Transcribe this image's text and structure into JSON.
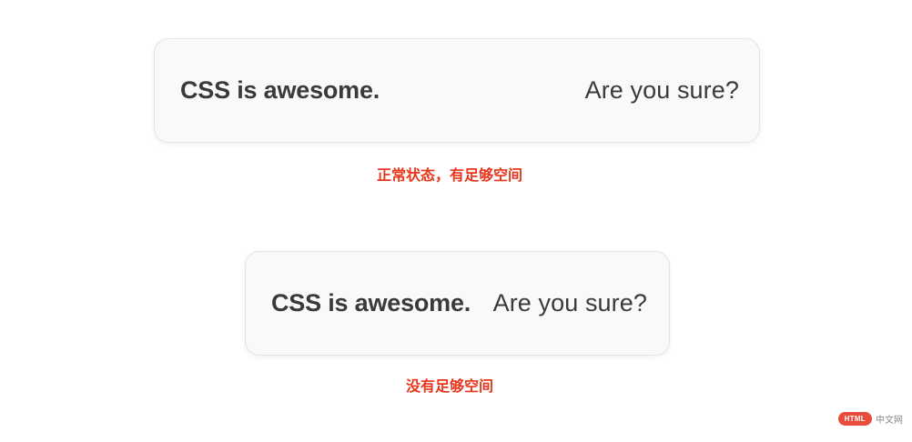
{
  "demo_normal": {
    "bold_text": "CSS is awesome.",
    "plain_text": "Are you sure?",
    "caption": "正常状态，有足够空间"
  },
  "demo_tight": {
    "bold_text": "CSS is awesome.",
    "plain_text": "Are you sure?",
    "caption": "没有足够空间"
  },
  "watermark": {
    "badge": "HTML",
    "text": "中文网"
  },
  "colors": {
    "caption": "#e8351b",
    "card_bg": "#f9f9f9",
    "card_border": "#e4e4e4",
    "text": "#3a3a3a"
  }
}
